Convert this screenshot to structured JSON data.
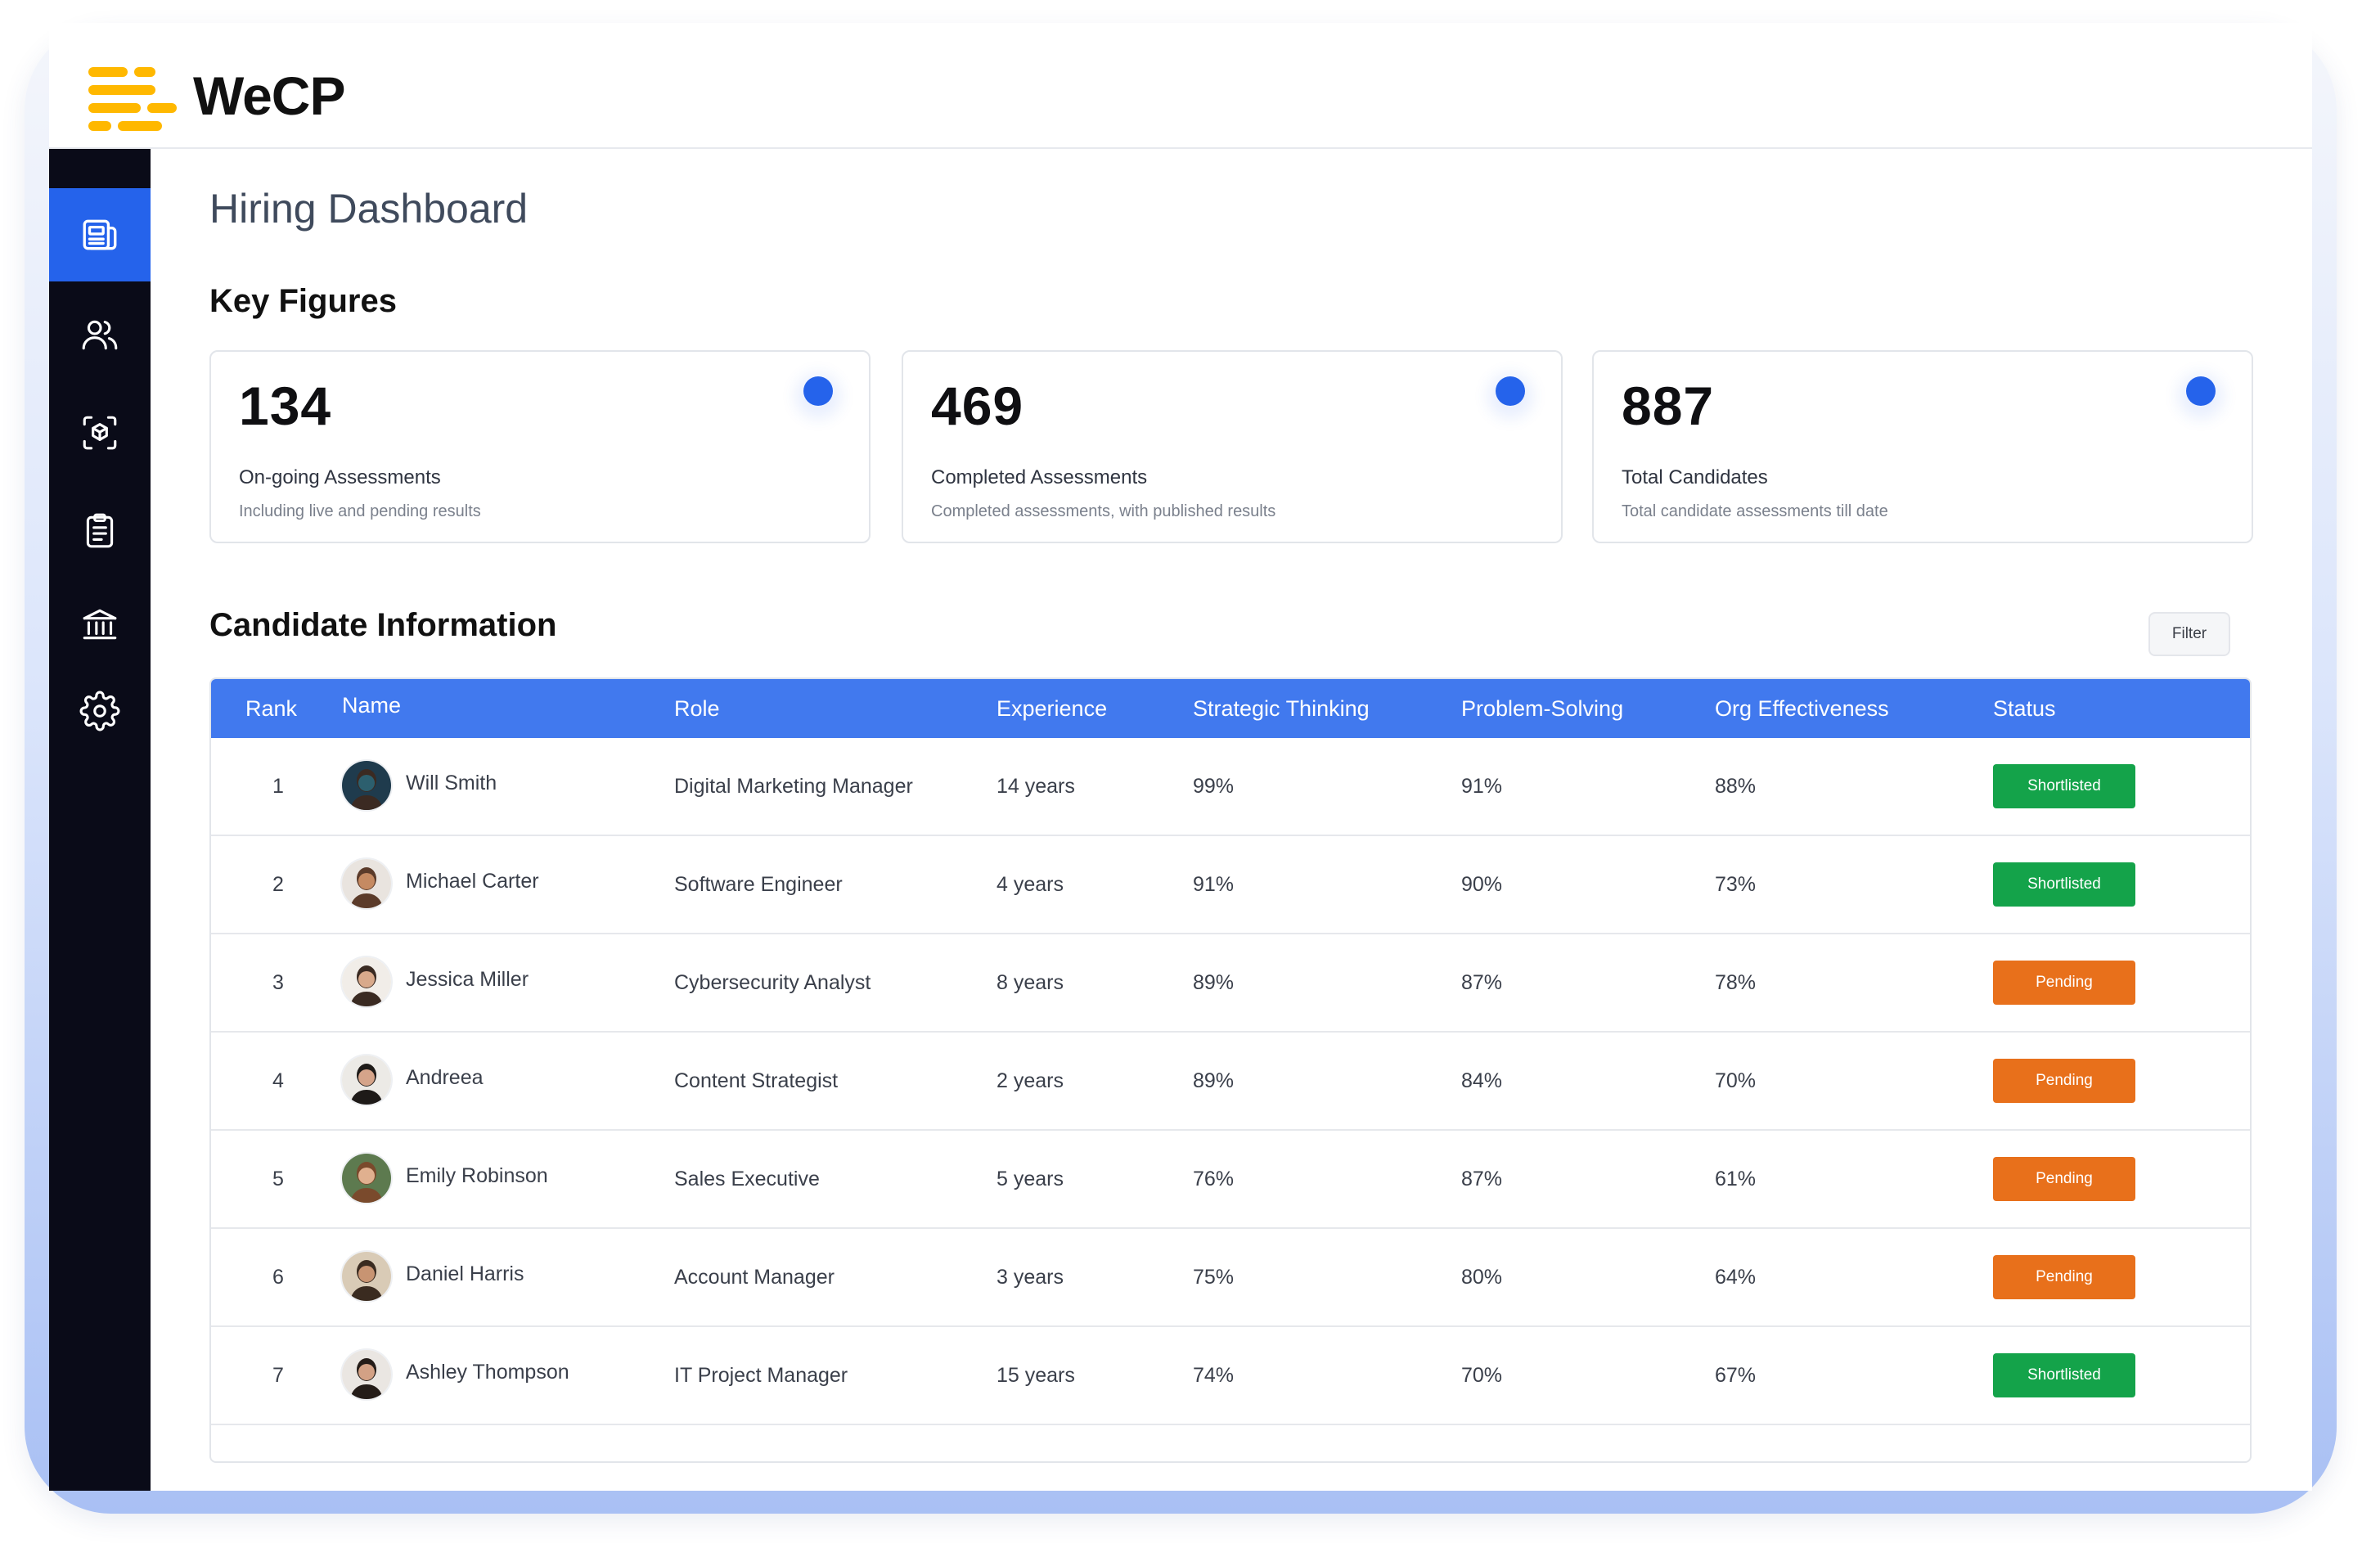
{
  "brand": {
    "name": "WeCP",
    "logo_colors": [
      "#ffb800",
      "#ffc21a"
    ]
  },
  "sidebar": {
    "accent": "#2563eb",
    "items": [
      {
        "icon": "newspaper-icon",
        "active": true
      },
      {
        "icon": "users-icon",
        "active": false
      },
      {
        "icon": "scan-cube-icon",
        "active": false
      },
      {
        "icon": "clipboard-icon",
        "active": false
      },
      {
        "icon": "institution-icon",
        "active": false
      },
      {
        "icon": "gear-icon",
        "active": false
      }
    ]
  },
  "page": {
    "title": "Hiring Dashboard",
    "key_figures_title": "Key Figures",
    "candidate_title": "Candidate Information",
    "filter_label": "Filter"
  },
  "kpis": [
    {
      "value": "134",
      "label": "On-going Assessments",
      "sub": "Including live and pending results"
    },
    {
      "value": "469",
      "label": "Completed Assessments",
      "sub": "Completed assessments, with published results"
    },
    {
      "value": "887",
      "label": "Total Candidates",
      "sub": "Total candidate assessments till date"
    }
  ],
  "table": {
    "header_color": "#4179ee",
    "columns": [
      "Rank",
      "Name",
      "Role",
      "Experience",
      "Strategic Thinking",
      "Problem-Solving",
      "Org Effectiveness",
      "Status"
    ],
    "rows": [
      {
        "rank": "1",
        "name": "Will Smith",
        "role": "Digital Marketing Manager",
        "experience": "14 years",
        "strategic": "99%",
        "problem": "91%",
        "org": "88%",
        "status": "Shortlisted"
      },
      {
        "rank": "2",
        "name": "Michael Carter",
        "role": "Software Engineer",
        "experience": "4 years",
        "strategic": "91%",
        "problem": "90%",
        "org": "73%",
        "status": "Shortlisted"
      },
      {
        "rank": "3",
        "name": "Jessica Miller",
        "role": "Cybersecurity Analyst",
        "experience": "8 years",
        "strategic": "89%",
        "problem": "87%",
        "org": "78%",
        "status": "Pending"
      },
      {
        "rank": "4",
        "name": "Andreea",
        "role": "Content Strategist",
        "experience": "2 years",
        "strategic": "89%",
        "problem": "84%",
        "org": "70%",
        "status": "Pending"
      },
      {
        "rank": "5",
        "name": "Emily Robinson",
        "role": "Sales Executive",
        "experience": "5 years",
        "strategic": "76%",
        "problem": "87%",
        "org": "61%",
        "status": "Pending"
      },
      {
        "rank": "6",
        "name": "Daniel Harris",
        "role": "Account Manager",
        "experience": "3 years",
        "strategic": "75%",
        "problem": "80%",
        "org": "64%",
        "status": "Pending"
      },
      {
        "rank": "7",
        "name": "Ashley Thompson",
        "role": "IT Project Manager",
        "experience": "15 years",
        "strategic": "74%",
        "problem": "70%",
        "org": "67%",
        "status": "Shortlisted"
      }
    ],
    "status_colors": {
      "Shortlisted": "#14a34a",
      "Pending": "#e8701b"
    }
  }
}
